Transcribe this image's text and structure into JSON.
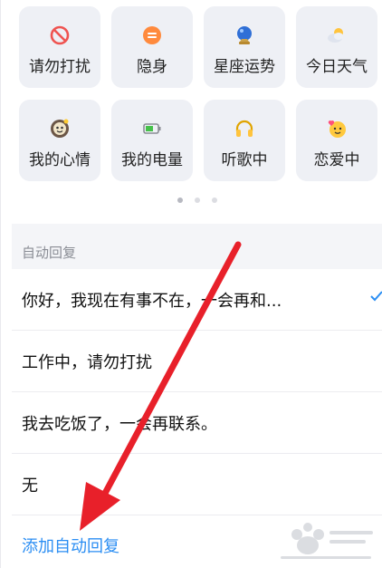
{
  "status_tiles": [
    {
      "label": "请勿打扰",
      "icon": "no-entry-icon"
    },
    {
      "label": "隐身",
      "icon": "invisible-icon"
    },
    {
      "label": "星座运势",
      "icon": "crystal-ball-icon"
    },
    {
      "label": "今日天气",
      "icon": "weather-icon"
    },
    {
      "label": "我的心情",
      "icon": "mood-icon"
    },
    {
      "label": "我的电量",
      "icon": "battery-icon"
    },
    {
      "label": "听歌中",
      "icon": "headphones-icon"
    },
    {
      "label": "恋爱中",
      "icon": "in-love-icon"
    }
  ],
  "pager": {
    "count": 3,
    "active": 0
  },
  "auto_reply": {
    "title": "自动回复",
    "items": [
      "你好，我现在有事不在，一会再和...",
      "工作中，请勿打扰",
      "我去吃饭了，一会再联系。",
      "无"
    ],
    "add_label": "添加自动回复"
  },
  "colors": {
    "accent": "#2b8ef3",
    "arrow": "#e8202a",
    "tile_bg": "#eef0f5"
  }
}
